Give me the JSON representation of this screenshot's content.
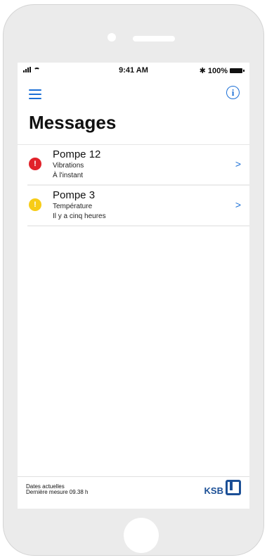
{
  "status_bar": {
    "time": "9:41 AM",
    "battery": "100%",
    "bluetooth_glyph": "✱"
  },
  "nav": {
    "menu_icon": "hamburger-icon",
    "info_glyph": "i"
  },
  "page": {
    "title": "Messages"
  },
  "messages": [
    {
      "title": "Pompe 12",
      "subtitle": "Vibrations",
      "time": "À l'instant",
      "severity_glyph": "!",
      "color": "#e1222a",
      "chevron": ">"
    },
    {
      "title": "Pompe 3",
      "subtitle": "Température",
      "time": "Il y a cinq heures",
      "severity_glyph": "!",
      "color": "#f7cc17",
      "chevron": ">"
    }
  ],
  "footer": {
    "line1": "Dates actuelles",
    "line2": "Dernière mesure 09.38 h",
    "logo_text": "KSB"
  },
  "colors": {
    "accent": "#1b6fd6",
    "brand": "#1b4f96"
  }
}
